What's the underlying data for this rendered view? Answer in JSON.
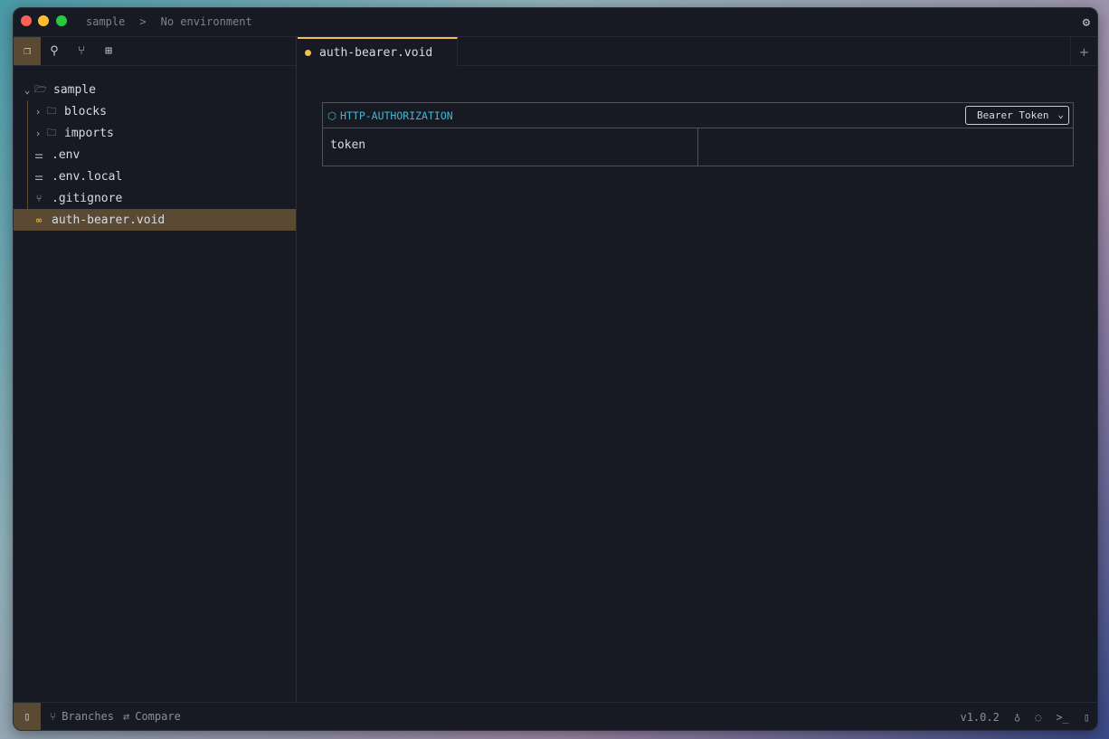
{
  "titlebar": {
    "project": "sample",
    "separator": ">",
    "environment": "No environment"
  },
  "tree": [
    {
      "label": "sample",
      "type": "folder-open",
      "depth": 0
    },
    {
      "label": "blocks",
      "type": "folder",
      "depth": 1
    },
    {
      "label": "imports",
      "type": "folder",
      "depth": 1
    },
    {
      "label": ".env",
      "type": "env",
      "depth": 1
    },
    {
      "label": ".env.local",
      "type": "env",
      "depth": 1
    },
    {
      "label": ".gitignore",
      "type": "git",
      "depth": 1
    },
    {
      "label": "auth-bearer.void",
      "type": "void",
      "depth": 1,
      "selected": true
    }
  ],
  "tabs": [
    {
      "label": "auth-bearer.void",
      "modified": true
    }
  ],
  "block": {
    "title": "HTTP-AUTHORIZATION",
    "auth_type": "Bearer Token",
    "key": "token",
    "value": ""
  },
  "status": {
    "branches": "Branches",
    "compare": "Compare",
    "version": "v1.0.2"
  },
  "colors": {
    "accent": "#f5c04a",
    "cyan": "#3fb8d4",
    "selection": "#5a4a33",
    "bg": "#171923"
  }
}
